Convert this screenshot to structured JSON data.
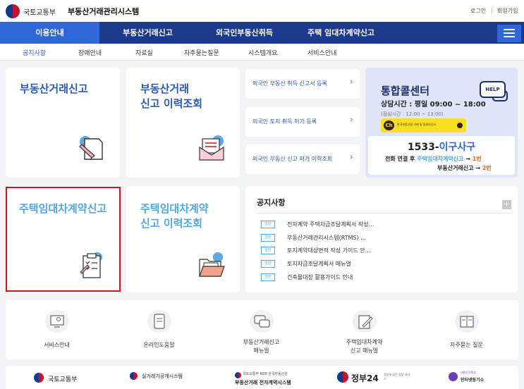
{
  "header": {
    "gov_name": "국토교통부",
    "site_title": "부동산거래관리시스템",
    "login": "로그인",
    "signup": "회원가입",
    "brand_color": "#1b3a8c"
  },
  "nav": {
    "items": [
      {
        "label": "이용안내"
      },
      {
        "label": "부동산거래신고"
      },
      {
        "label": "외국인부동산취득"
      },
      {
        "label": "주택 임대차계약신고"
      }
    ],
    "active_index": 0,
    "menu_icon": "hamburger-icon"
  },
  "subnav": {
    "items": [
      "공지사항",
      "장애안내",
      "자료실",
      "자주묻는질문",
      "시스템개요",
      "서비스안내"
    ],
    "active_index": 0
  },
  "cards": {
    "real_estate_report": {
      "title": "부동산거래신고",
      "icon": "pen-document-icon"
    },
    "real_estate_history": {
      "title_line1": "부동산거래",
      "title_line2": "신고 이력조회",
      "icon": "envelope-icon"
    },
    "lease_report": {
      "title": "주택임대차계약신고",
      "icon": "clipboard-icon"
    },
    "lease_history": {
      "title_line1": "주택임대차계약",
      "title_line2": "신고 이력조회",
      "icon": "folder-icon"
    }
  },
  "foreign_links": [
    {
      "label": "외국인 부동산 취득 신고서 등록"
    },
    {
      "label": "외국인 토지 취득 허가 등록"
    },
    {
      "label": "외국인 부동산 신고 허가 이력조회"
    }
  ],
  "call_center": {
    "title": "통합콜센터",
    "hours": "상담시간 : 평일 09:00 ~ 18:00",
    "lunch": "(점심시간 : 12:00 ~ 13:00)",
    "kakao_ch": "Ch",
    "kakao_text": "한국부동산원 거래 및 임대차신고",
    "help": "HELP",
    "phone_prefix": "1533-",
    "phone_highlight": "이구사구",
    "line1_prefix": "전화 연결 후 ",
    "line1_service": "주택임대차계약신고",
    "line1_arrow": " → ",
    "line1_button": "1번",
    "line2_service": "부동산거래신고",
    "line2_arrow": " → ",
    "line2_button": "2번"
  },
  "notice": {
    "title": "공지사항",
    "more": "+",
    "badge": "일반",
    "items": [
      "전자계약 주택자금조달계획서 작성...",
      "부동산거래관리시스템(RTMS) ...",
      "토지계약대상면적 작성 가이드 안...",
      "토지자금조달계획서 매뉴얼",
      "건축물대장 활용가이드 안내"
    ]
  },
  "quick_links": [
    {
      "line1": "서비스안내",
      "line2": "",
      "icon": "monitor-icon"
    },
    {
      "line1": "온라인도움말",
      "line2": "",
      "icon": "tablet-icon"
    },
    {
      "line1": "부동산거래신고",
      "line2": "매뉴얼",
      "icon": "chat-icon"
    },
    {
      "line1": "주택임대차계약",
      "line2": "신고 매뉴얼",
      "icon": "pen-note-icon"
    },
    {
      "line1": "자주묻는 질문",
      "line2": "",
      "icon": "book-icon"
    }
  ],
  "footer": {
    "logo1": "국토교통부",
    "logo2": "실거래가공개시스템",
    "logo3_top": "국토교통부 REB 한국부동산원",
    "logo3_main": "부동산거래 전자계약시스템",
    "logo4": "정부24",
    "logo4_sub": "정부에 모든 정부 서비스",
    "logo5_top": "대한민국정부",
    "logo5_main": "인터넷등기소"
  }
}
